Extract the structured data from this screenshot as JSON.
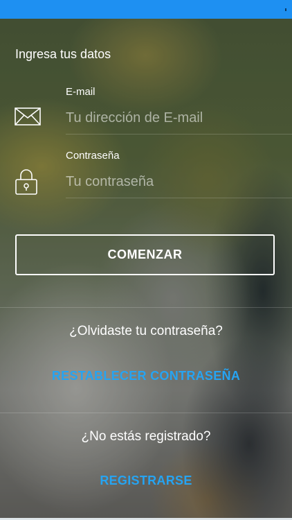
{
  "colors": {
    "status_bar": "#1e90f2",
    "link": "#26a4f2",
    "text": "#ffffff"
  },
  "login": {
    "heading": "Ingresa tus datos",
    "email": {
      "label": "E-mail",
      "placeholder": "Tu dirección de E-mail",
      "value": "",
      "icon": "envelope-icon"
    },
    "password": {
      "label": "Contraseña",
      "placeholder": "Tu contraseña",
      "value": "",
      "icon": "lock-icon"
    },
    "start_button": "COMENZAR"
  },
  "forgot": {
    "question": "¿Olvidaste tu contraseña?",
    "reset_link": "RESTABLECER CONTRASEÑA"
  },
  "register": {
    "question": "¿No estás registrado?",
    "register_link": "REGISTRARSE"
  }
}
